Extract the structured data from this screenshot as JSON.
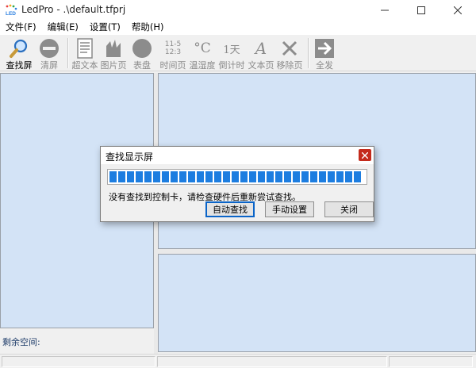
{
  "window": {
    "title": "LedPro - .\\default.tfprj"
  },
  "menu": [
    "文件(F)",
    "编辑(E)",
    "设置(T)",
    "帮助(H)"
  ],
  "toolbar": {
    "find_screen": "查找屏",
    "clear_screen": "清屏",
    "super_text": "超文本",
    "picture_page": "图片页",
    "dial": "表盘",
    "time_page": "时间页",
    "temp_humidity": "温湿度",
    "countdown": "倒计时",
    "text_page": "文本页",
    "remove_page": "移除页",
    "send_all": "全发",
    "time_icon_line1": "11-5",
    "time_icon_line2": "12:3",
    "temp_icon_text": "°C",
    "countdown_icon_text": "1天",
    "text_icon_text": "A"
  },
  "left_pane": {
    "space_label": "剩余空间:"
  },
  "dialog": {
    "title": "查找显示屏",
    "progress_blocks": 30,
    "message": "没有查找到控制卡，请检查硬件后重新尝试查找。",
    "auto_find": "自动查找",
    "manual_settings": "手动设置",
    "close": "关闭"
  },
  "colors": {
    "pane_bg": "#d3e3f6",
    "progress": "#1c7de0",
    "close_red": "#c42b1c"
  }
}
